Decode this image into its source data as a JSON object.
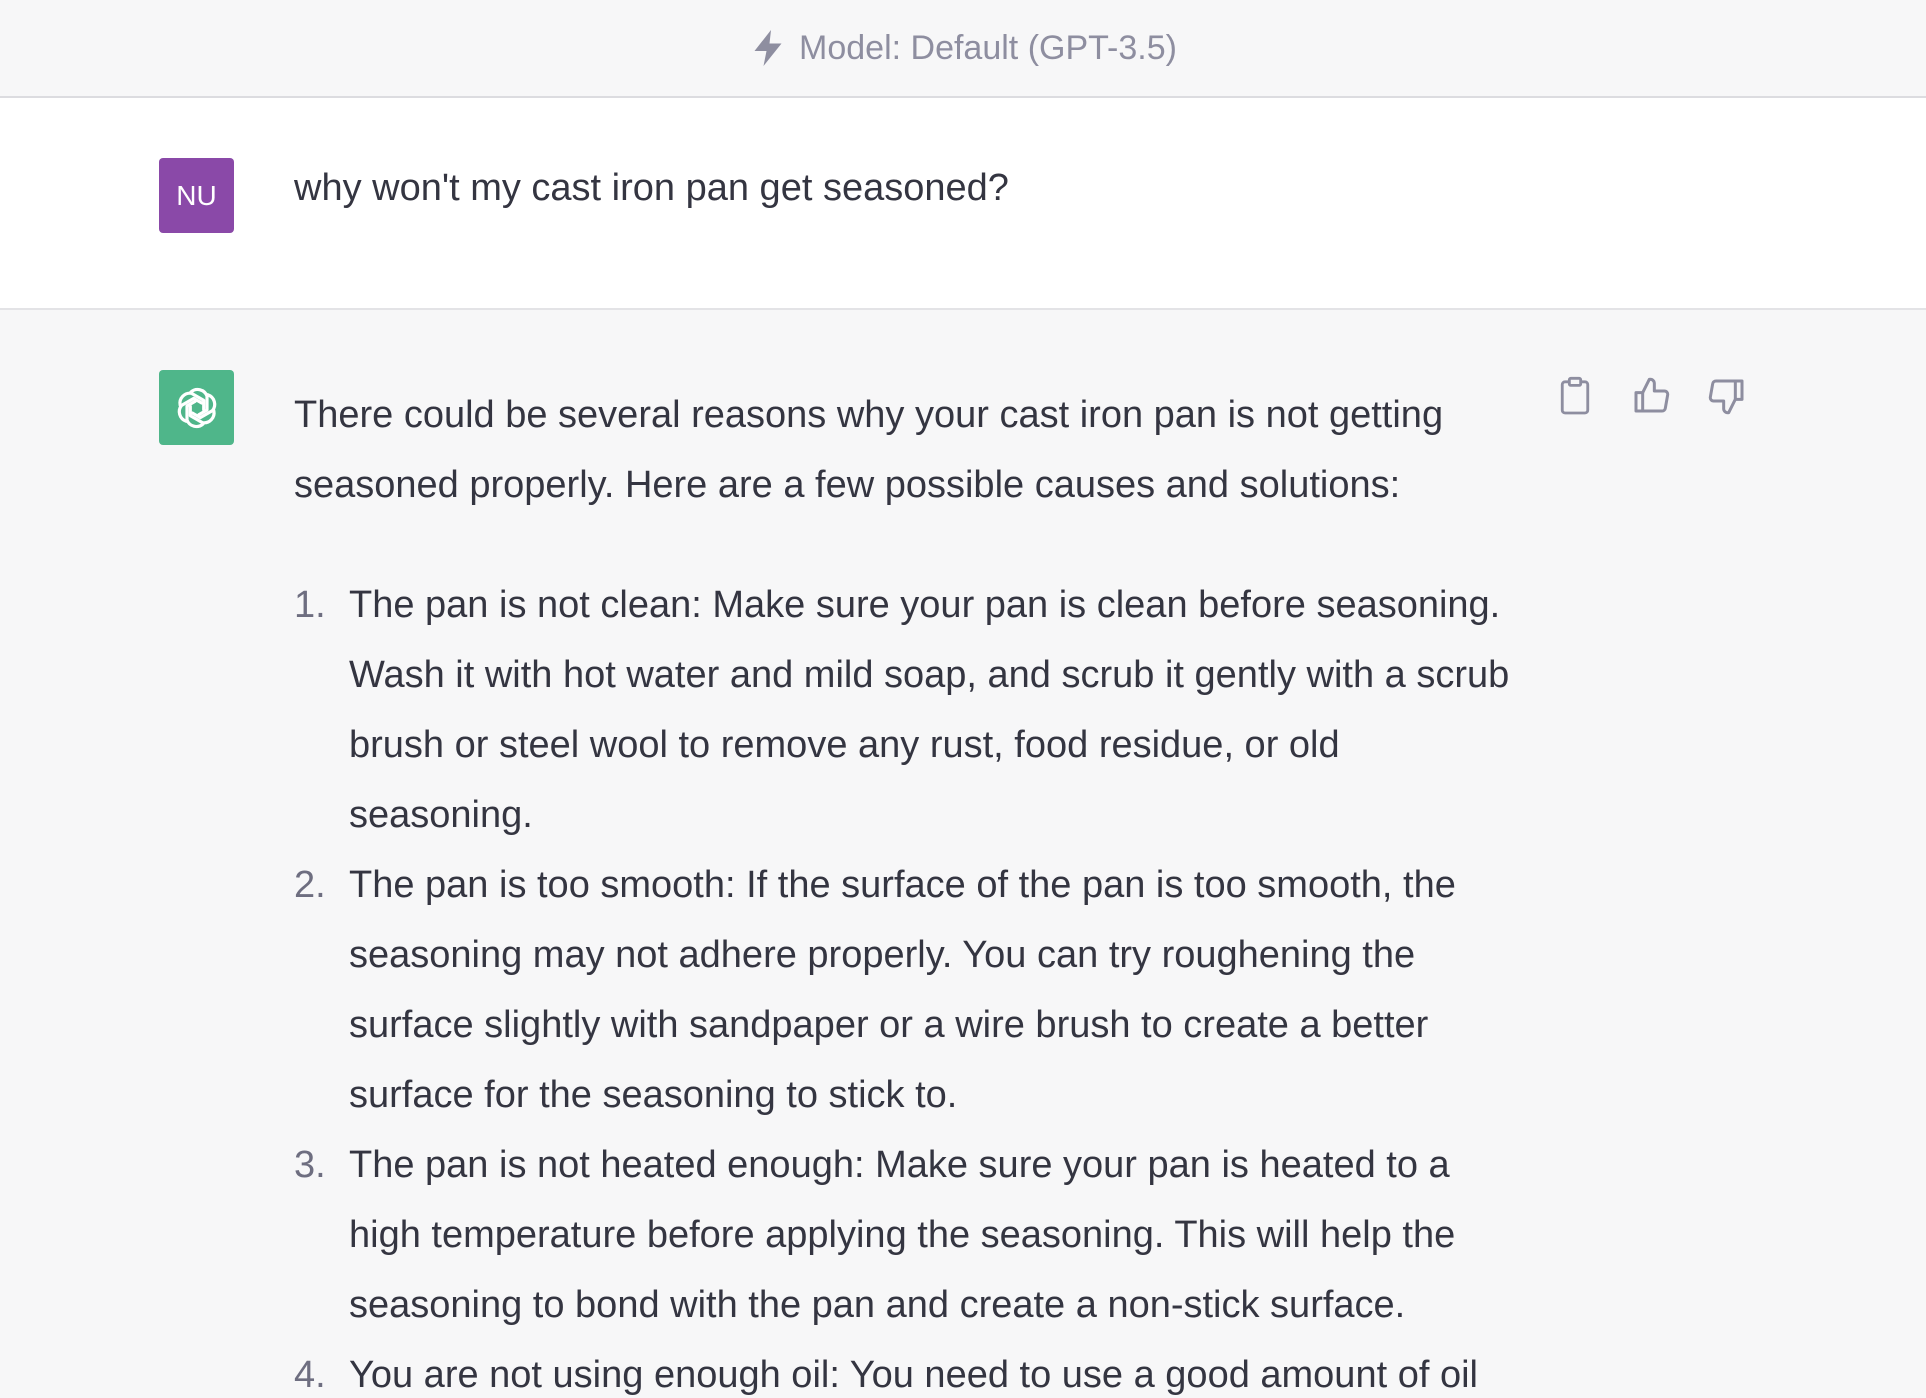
{
  "header": {
    "model_label": "Model: Default (GPT-3.5)"
  },
  "user_message": {
    "avatar_initials": "NU",
    "text": "why won't my cast iron pan get seasoned?"
  },
  "assistant_message": {
    "intro": "There could be several reasons why your cast iron pan is not getting seasoned properly. Here are a few possible causes and solutions:",
    "items": [
      {
        "number": "1.",
        "text": "The pan is not clean: Make sure your pan is clean before seasoning. Wash it with hot water and mild soap, and scrub it gently with a scrub brush or steel wool to remove any rust, food residue, or old seasoning."
      },
      {
        "number": "2.",
        "text": "The pan is too smooth: If the surface of the pan is too smooth, the seasoning may not adhere properly. You can try roughening the surface slightly with sandpaper or a wire brush to create a better surface for the seasoning to stick to."
      },
      {
        "number": "3.",
        "text": "The pan is not heated enough: Make sure your pan is heated to a high temperature before applying the seasoning. This will help the seasoning to bond with the pan and create a non-stick surface."
      },
      {
        "number": "4.",
        "text": "You are not using enough oil: You need to use a good amount of oil"
      }
    ]
  },
  "icons": {
    "header": "lightning-bolt-icon",
    "assistant_avatar": "openai-logo-icon",
    "actions": [
      "clipboard-icon",
      "thumbs-up-icon",
      "thumbs-down-icon"
    ]
  },
  "colors": {
    "user_avatar": "#8a49a8",
    "assistant_avatar": "#4fb68a",
    "muted_text": "#8e8ea0"
  }
}
